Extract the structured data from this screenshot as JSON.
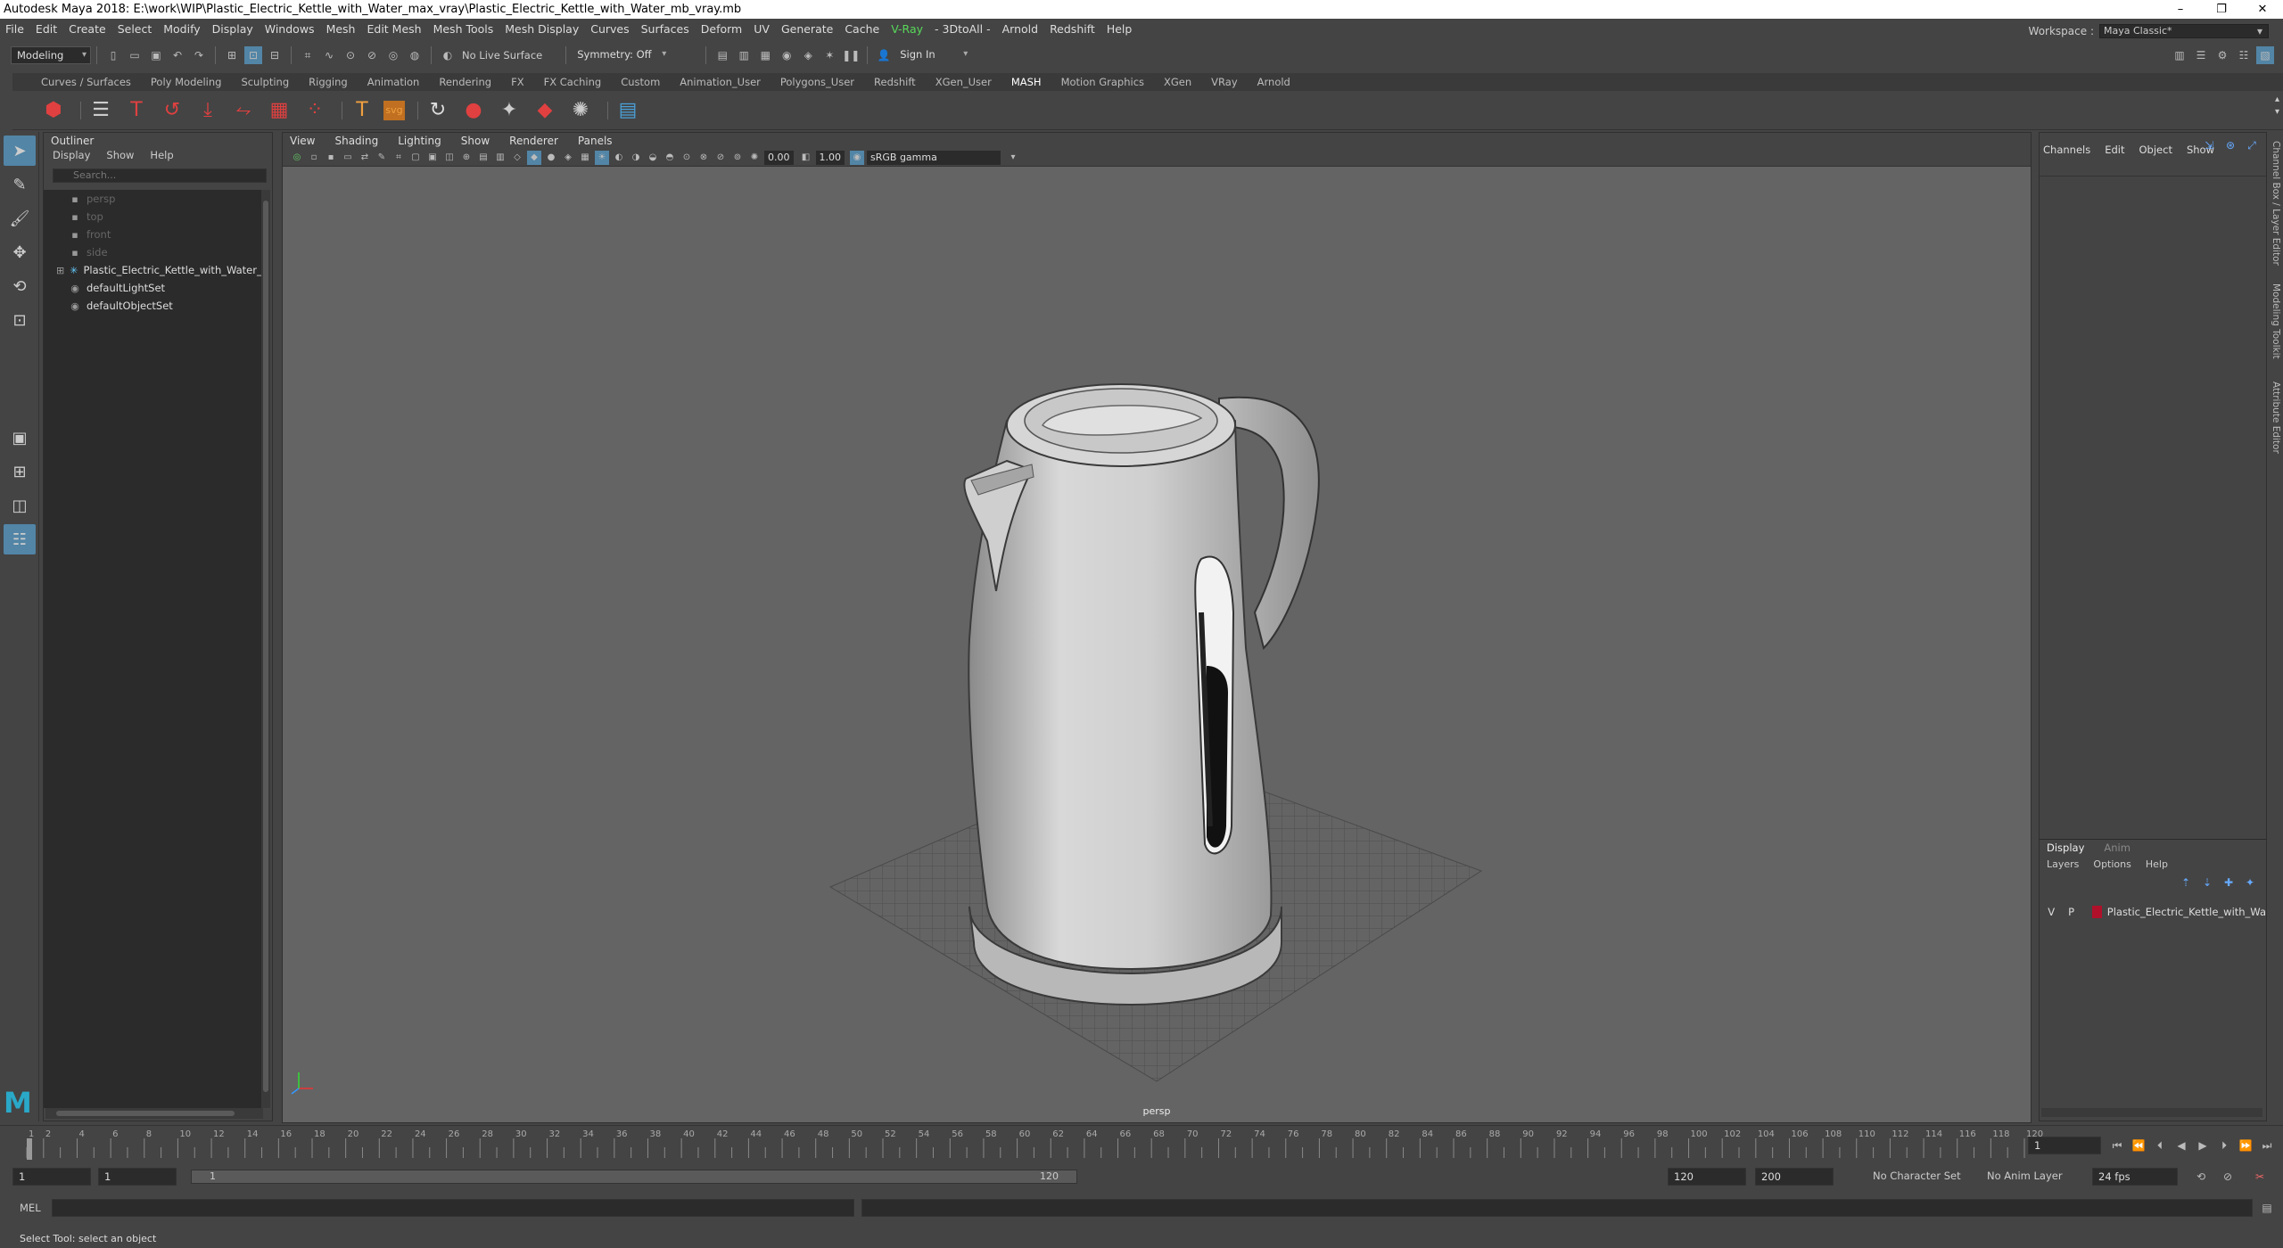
{
  "window": {
    "title": "Autodesk Maya 2018: E:\\work\\WIP\\Plastic_Electric_Kettle_with_Water_max_vray\\Plastic_Electric_Kettle_with_Water_mb_vray.mb",
    "minimize": "–",
    "restore": "❐",
    "close": "✕"
  },
  "menu": [
    "File",
    "Edit",
    "Create",
    "Select",
    "Modify",
    "Display",
    "Windows",
    "Mesh",
    "Edit Mesh",
    "Mesh Tools",
    "Mesh Display",
    "Curves",
    "Surfaces",
    "Deform",
    "UV",
    "Generate",
    "Cache",
    "V-Ray",
    "- 3DtoAll -",
    "Arnold",
    "Redshift",
    "Help"
  ],
  "workspace": {
    "label": "Workspace :",
    "value": "Maya Classic*"
  },
  "statusline": {
    "mode": "Modeling",
    "live_surface": "No Live Surface",
    "symmetry": "Symmetry: Off",
    "sign_in": "Sign In"
  },
  "shelf_tabs": [
    "Curves / Surfaces",
    "Poly Modeling",
    "Sculpting",
    "Rigging",
    "Animation",
    "Rendering",
    "FX",
    "FX Caching",
    "Custom",
    "Animation_User",
    "Polygons_User",
    "Redshift",
    "XGen_User",
    "MASH",
    "Motion Graphics",
    "XGen",
    "VRay",
    "Arnold"
  ],
  "shelf_active": "MASH",
  "outliner": {
    "title": "Outliner",
    "menu": [
      "Display",
      "Show",
      "Help"
    ],
    "search_placeholder": "Search...",
    "items": [
      {
        "label": "persp",
        "dim": true
      },
      {
        "label": "top",
        "dim": true
      },
      {
        "label": "front",
        "dim": true
      },
      {
        "label": "side",
        "dim": true
      },
      {
        "label": "Plastic_Electric_Kettle_with_Water_ncl",
        "dim": false
      },
      {
        "label": "defaultLightSet",
        "dim": false
      },
      {
        "label": "defaultObjectSet",
        "dim": false
      }
    ]
  },
  "viewport": {
    "menu": [
      "View",
      "Shading",
      "Lighting",
      "Show",
      "Renderer",
      "Panels"
    ],
    "exposure": "0.00",
    "gamma": "1.00",
    "colorspace": "sRGB gamma",
    "camera_label": "persp"
  },
  "channelbox": {
    "menu": [
      "Channels",
      "Edit",
      "Object",
      "Show"
    ]
  },
  "layers": {
    "tabs": [
      "Display",
      "Anim"
    ],
    "menu": [
      "Layers",
      "Options",
      "Help"
    ],
    "row": {
      "v": "V",
      "p": "P",
      "name": "Plastic_Electric_Kettle_with_Wa",
      "color": "#b0102a"
    }
  },
  "side_tabs": [
    "Channel Box / Layer Editor",
    "Modeling Toolkit",
    "Attribute Editor"
  ],
  "timeline": {
    "ticks": [
      "1",
      "2",
      "4",
      "6",
      "8",
      "10",
      "12",
      "14",
      "16",
      "18",
      "20",
      "22",
      "24",
      "26",
      "28",
      "30",
      "32",
      "34",
      "36",
      "38",
      "40",
      "42",
      "44",
      "46",
      "48",
      "50",
      "52",
      "54",
      "56",
      "58",
      "60",
      "62",
      "64",
      "66",
      "68",
      "70",
      "72",
      "74",
      "76",
      "78",
      "80",
      "82",
      "84",
      "86",
      "88",
      "90",
      "92",
      "94",
      "96",
      "98",
      "100",
      "102",
      "104",
      "106",
      "108",
      "110",
      "112",
      "114",
      "116",
      "118",
      "120"
    ],
    "current_frame": "1"
  },
  "range": {
    "start": "1",
    "min": "1",
    "bar_start": "1",
    "bar_end": "120",
    "end": "120",
    "max": "200",
    "character_set": "No Character Set",
    "anim_layer": "No Anim Layer",
    "fps": "24 fps"
  },
  "cmd": {
    "label": "MEL"
  },
  "helpline": "Select Tool: select an object"
}
